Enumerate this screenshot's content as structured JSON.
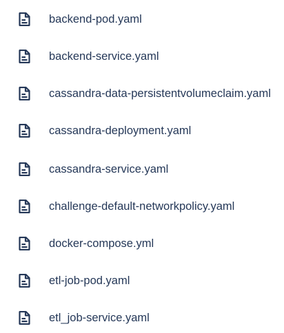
{
  "files": [
    {
      "name": "backend-pod.yaml",
      "icon": "file-text-icon"
    },
    {
      "name": "backend-service.yaml",
      "icon": "file-text-icon"
    },
    {
      "name": "cassandra-data-persistentvolumeclaim.yaml",
      "icon": "file-text-icon"
    },
    {
      "name": "cassandra-deployment.yaml",
      "icon": "file-text-icon"
    },
    {
      "name": "cassandra-service.yaml",
      "icon": "file-text-icon"
    },
    {
      "name": "challenge-default-networkpolicy.yaml",
      "icon": "file-text-icon"
    },
    {
      "name": "docker-compose.yml",
      "icon": "file-text-icon"
    },
    {
      "name": "etl-job-pod.yaml",
      "icon": "file-text-icon"
    },
    {
      "name": "etl_job-service.yaml",
      "icon": "file-text-icon"
    }
  ],
  "colors": {
    "text": "#253858",
    "icon": "#253858",
    "background": "#ffffff"
  }
}
